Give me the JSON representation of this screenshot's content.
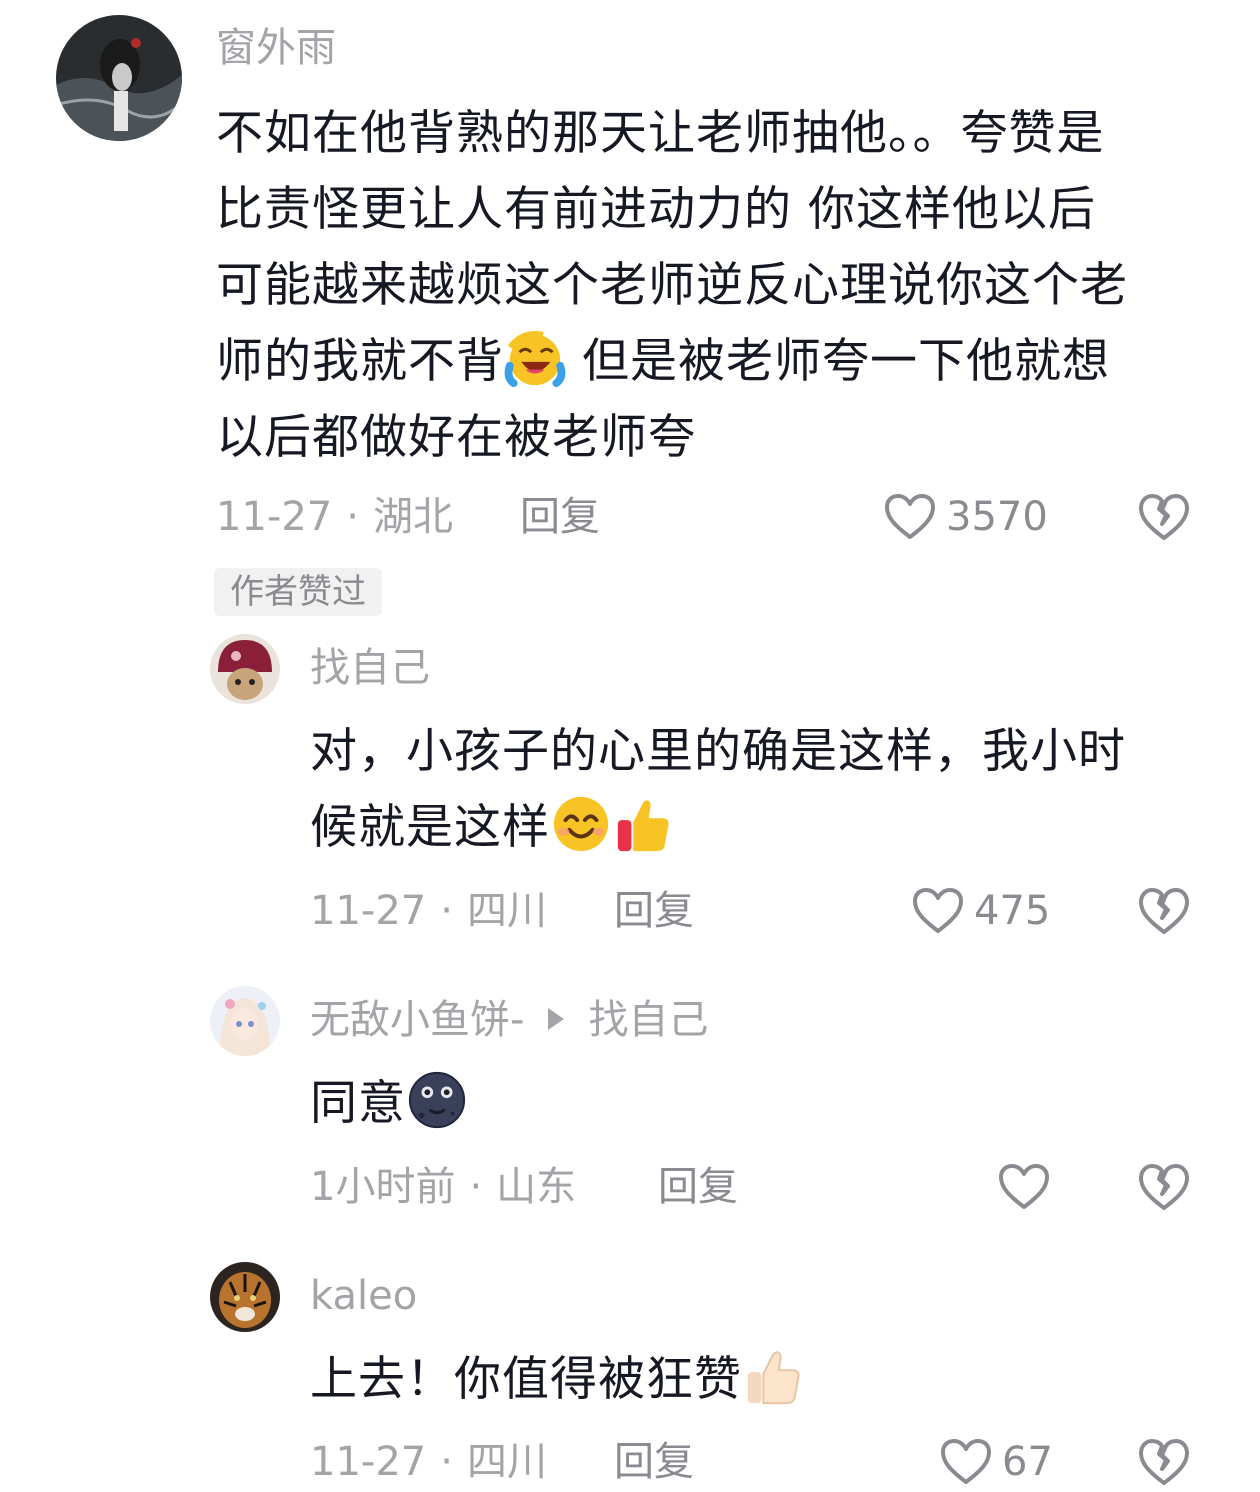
{
  "comments": [
    {
      "username": "窗外雨",
      "text_lines": [
        "不如在他背熟的那天让老师抽他。。夸赞是",
        "比责怪更让人有前进动力的 你这样他以后",
        "可能越来越烦这个老师逆反心理说你这个老",
        "师的我就不背",
        " 但是被老师夸一下他就想",
        "以后都做好在被老师夸"
      ],
      "date": "11-27",
      "location": "湖北",
      "reply_label": "回复",
      "likes": "3570",
      "author_liked": "作者赞过"
    },
    {
      "username": "找自己",
      "text_line1": "对，小孩子的心里的确是这样，我小时",
      "text_line2": "候就是这样",
      "date": "11-27",
      "location": "四川",
      "reply_label": "回复",
      "likes": "475"
    },
    {
      "username": "无敌小鱼饼-",
      "reply_to": "找自己",
      "text": "同意",
      "date": "1小时前",
      "location": "山东",
      "reply_label": "回复",
      "likes": ""
    },
    {
      "username": "kaleo",
      "text": "上去！你值得被狂赞",
      "date": "11-27",
      "location": "四川",
      "reply_label": "回复",
      "likes": "67"
    }
  ],
  "separator": "·",
  "icons": {
    "like": "heart-outline-icon",
    "dislike": "broken-heart-icon"
  },
  "colors": {
    "text": "#161823",
    "secondary": "#a3a3a8",
    "icon": "#8a8a90"
  }
}
